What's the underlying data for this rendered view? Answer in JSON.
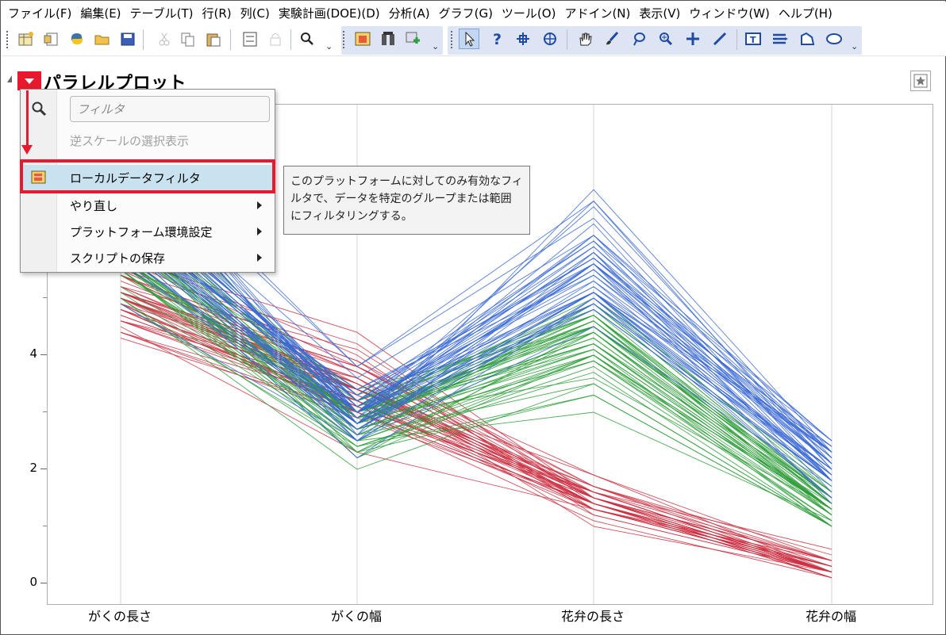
{
  "menubar": {
    "items": [
      "ファイル(F)",
      "編集(E)",
      "テーブル(T)",
      "行(R)",
      "列(C)",
      "実験計画(DOE)(D)",
      "分析(A)",
      "グラフ(G)",
      "ツール(O)",
      "アドイン(N)",
      "表示(V)",
      "ウィンドウ(W)",
      "ヘルプ(H)"
    ]
  },
  "toolbar": {
    "icons": [
      "new-data-table-icon",
      "new-script-icon",
      "python-icon",
      "open-folder-icon",
      "save-icon",
      "cut-icon",
      "copy-icon",
      "paste-icon",
      "fit-window-icon",
      "lock-icon",
      "search-icon",
      "data-table-icon",
      "column-icon",
      "add-icon",
      "arrow-tool-icon",
      "help-tool-icon",
      "crosshair-tool-icon",
      "target-tool-icon",
      "hand-tool-icon",
      "brush-tool-icon",
      "lasso-tool-icon",
      "zoom-tool-icon",
      "plus-tool-icon",
      "line-tool-icon",
      "text-tool-icon",
      "list-tool-icon",
      "shape-tool-icon",
      "ellipse-tool-icon"
    ]
  },
  "report": {
    "title": "パラレルプロット"
  },
  "context_menu": {
    "filter_placeholder": "フィルタ",
    "items": [
      {
        "label": "逆スケールの選択表示",
        "disabled": true
      },
      {
        "label": "ローカルデータフィルタ",
        "highlighted": true
      },
      {
        "label": "やり直し",
        "submenu": true
      },
      {
        "label": "プラットフォーム環境設定",
        "submenu": true
      },
      {
        "label": "スクリプトの保存",
        "submenu": true
      }
    ]
  },
  "tooltip": {
    "lines": [
      "このプラットフォームに対してのみ有効なフィ",
      "ルタで、データを特定のグループまたは範囲",
      "にフィルタリングする。"
    ]
  },
  "colors": {
    "accent_red": "#e8192c",
    "setosa": "#cc3344",
    "versicolor": "#2e9e3a",
    "virginica": "#3a68d6"
  },
  "chart_data": {
    "type": "line",
    "title": "パラレルプロット",
    "categories": [
      "がくの長さ",
      "がくの幅",
      "花弁の長さ",
      "花弁の幅"
    ],
    "y_ticks": [
      "0",
      "2",
      "4"
    ],
    "ylim": [
      0,
      8.9
    ],
    "grid": true,
    "series": [
      {
        "group": "setosa",
        "color": "#cc3344",
        "lines": [
          [
            5.1,
            3.5,
            1.4,
            0.2
          ],
          [
            4.9,
            3.0,
            1.4,
            0.2
          ],
          [
            4.7,
            3.2,
            1.3,
            0.2
          ],
          [
            4.6,
            3.1,
            1.5,
            0.2
          ],
          [
            5.0,
            3.6,
            1.4,
            0.2
          ],
          [
            5.4,
            3.9,
            1.7,
            0.4
          ],
          [
            4.6,
            3.4,
            1.4,
            0.3
          ],
          [
            5.0,
            3.4,
            1.5,
            0.2
          ],
          [
            4.4,
            2.9,
            1.4,
            0.2
          ],
          [
            4.9,
            3.1,
            1.5,
            0.1
          ],
          [
            5.4,
            3.7,
            1.5,
            0.2
          ],
          [
            4.8,
            3.4,
            1.6,
            0.2
          ],
          [
            4.8,
            3.0,
            1.4,
            0.1
          ],
          [
            4.3,
            3.0,
            1.1,
            0.1
          ],
          [
            5.8,
            4.0,
            1.2,
            0.2
          ],
          [
            5.7,
            4.4,
            1.5,
            0.4
          ],
          [
            5.4,
            3.9,
            1.3,
            0.4
          ],
          [
            5.1,
            3.5,
            1.4,
            0.3
          ],
          [
            5.7,
            3.8,
            1.7,
            0.3
          ],
          [
            5.1,
            3.8,
            1.5,
            0.3
          ],
          [
            5.4,
            3.4,
            1.7,
            0.2
          ],
          [
            5.1,
            3.7,
            1.5,
            0.4
          ],
          [
            4.6,
            3.6,
            1.0,
            0.2
          ],
          [
            5.1,
            3.3,
            1.7,
            0.5
          ],
          [
            4.8,
            3.4,
            1.9,
            0.2
          ],
          [
            5.0,
            3.0,
            1.6,
            0.2
          ],
          [
            5.0,
            3.4,
            1.6,
            0.4
          ],
          [
            5.2,
            3.5,
            1.5,
            0.2
          ],
          [
            5.2,
            3.4,
            1.4,
            0.2
          ],
          [
            4.7,
            3.2,
            1.6,
            0.2
          ],
          [
            4.8,
            3.1,
            1.6,
            0.2
          ],
          [
            5.4,
            3.4,
            1.5,
            0.4
          ],
          [
            5.2,
            4.1,
            1.5,
            0.1
          ],
          [
            5.5,
            4.2,
            1.4,
            0.2
          ],
          [
            4.9,
            3.1,
            1.5,
            0.2
          ],
          [
            5.0,
            3.2,
            1.2,
            0.2
          ],
          [
            5.5,
            3.5,
            1.3,
            0.2
          ],
          [
            4.9,
            3.6,
            1.4,
            0.1
          ],
          [
            4.4,
            3.0,
            1.3,
            0.2
          ],
          [
            5.1,
            3.4,
            1.5,
            0.2
          ],
          [
            5.0,
            3.5,
            1.3,
            0.3
          ],
          [
            4.5,
            2.3,
            1.3,
            0.3
          ],
          [
            4.4,
            3.2,
            1.3,
            0.2
          ],
          [
            5.0,
            3.5,
            1.6,
            0.6
          ],
          [
            5.1,
            3.8,
            1.9,
            0.4
          ],
          [
            4.8,
            3.0,
            1.4,
            0.3
          ],
          [
            5.1,
            3.8,
            1.6,
            0.2
          ],
          [
            4.6,
            3.2,
            1.4,
            0.2
          ],
          [
            5.3,
            3.7,
            1.5,
            0.2
          ],
          [
            5.0,
            3.3,
            1.4,
            0.2
          ]
        ]
      },
      {
        "group": "versicolor",
        "color": "#2e9e3a",
        "lines": [
          [
            7.0,
            3.2,
            4.7,
            1.4
          ],
          [
            6.4,
            3.2,
            4.5,
            1.5
          ],
          [
            6.9,
            3.1,
            4.9,
            1.5
          ],
          [
            5.5,
            2.3,
            4.0,
            1.3
          ],
          [
            6.5,
            2.8,
            4.6,
            1.5
          ],
          [
            5.7,
            2.8,
            4.5,
            1.3
          ],
          [
            6.3,
            3.3,
            4.7,
            1.6
          ],
          [
            4.9,
            2.4,
            3.3,
            1.0
          ],
          [
            6.6,
            2.9,
            4.6,
            1.3
          ],
          [
            5.2,
            2.7,
            3.9,
            1.4
          ],
          [
            5.0,
            2.0,
            3.5,
            1.0
          ],
          [
            5.9,
            3.0,
            4.2,
            1.5
          ],
          [
            6.0,
            2.2,
            4.0,
            1.0
          ],
          [
            6.1,
            2.9,
            4.7,
            1.4
          ],
          [
            5.6,
            2.9,
            3.6,
            1.3
          ],
          [
            6.7,
            3.1,
            4.4,
            1.4
          ],
          [
            5.6,
            3.0,
            4.5,
            1.5
          ],
          [
            5.8,
            2.7,
            4.1,
            1.0
          ],
          [
            6.2,
            2.2,
            4.5,
            1.5
          ],
          [
            5.6,
            2.5,
            3.9,
            1.1
          ],
          [
            5.9,
            3.2,
            4.8,
            1.8
          ],
          [
            6.1,
            2.8,
            4.0,
            1.3
          ],
          [
            6.3,
            2.5,
            4.9,
            1.5
          ],
          [
            6.1,
            2.8,
            4.7,
            1.2
          ],
          [
            6.4,
            2.9,
            4.3,
            1.3
          ],
          [
            6.6,
            3.0,
            4.4,
            1.4
          ],
          [
            6.8,
            2.8,
            4.8,
            1.4
          ],
          [
            6.7,
            3.0,
            5.0,
            1.7
          ],
          [
            6.0,
            2.9,
            4.5,
            1.5
          ],
          [
            5.7,
            2.6,
            3.5,
            1.0
          ],
          [
            5.5,
            2.4,
            3.8,
            1.1
          ],
          [
            5.5,
            2.4,
            3.7,
            1.0
          ],
          [
            5.8,
            2.7,
            3.9,
            1.2
          ],
          [
            6.0,
            2.7,
            5.1,
            1.6
          ],
          [
            5.4,
            3.0,
            4.5,
            1.5
          ],
          [
            6.0,
            3.4,
            4.5,
            1.6
          ],
          [
            6.7,
            3.1,
            4.7,
            1.5
          ],
          [
            6.3,
            2.3,
            4.4,
            1.3
          ],
          [
            5.6,
            3.0,
            4.1,
            1.3
          ],
          [
            5.5,
            2.5,
            4.0,
            1.3
          ],
          [
            5.5,
            2.6,
            4.4,
            1.2
          ],
          [
            6.1,
            3.0,
            4.6,
            1.4
          ],
          [
            5.8,
            2.6,
            4.0,
            1.2
          ],
          [
            5.0,
            2.3,
            3.3,
            1.0
          ],
          [
            5.6,
            2.7,
            4.2,
            1.3
          ],
          [
            5.7,
            3.0,
            4.2,
            1.2
          ],
          [
            5.7,
            2.9,
            4.2,
            1.3
          ],
          [
            6.2,
            2.9,
            4.3,
            1.3
          ],
          [
            5.1,
            2.5,
            3.0,
            1.1
          ],
          [
            5.7,
            2.8,
            4.1,
            1.3
          ]
        ]
      },
      {
        "group": "virginica",
        "color": "#3a68d6",
        "lines": [
          [
            6.3,
            3.3,
            6.0,
            2.5
          ],
          [
            5.8,
            2.7,
            5.1,
            1.9
          ],
          [
            7.1,
            3.0,
            5.9,
            2.1
          ],
          [
            6.3,
            2.9,
            5.6,
            1.8
          ],
          [
            6.5,
            3.0,
            5.8,
            2.2
          ],
          [
            7.6,
            3.0,
            6.6,
            2.1
          ],
          [
            4.9,
            2.5,
            4.5,
            1.7
          ],
          [
            7.3,
            2.9,
            6.3,
            1.8
          ],
          [
            6.7,
            2.5,
            5.8,
            1.8
          ],
          [
            7.2,
            3.6,
            6.1,
            2.5
          ],
          [
            6.5,
            3.2,
            5.1,
            2.0
          ],
          [
            6.4,
            2.7,
            5.3,
            1.9
          ],
          [
            6.8,
            3.0,
            5.5,
            2.1
          ],
          [
            5.7,
            2.5,
            5.0,
            2.0
          ],
          [
            5.8,
            2.8,
            5.1,
            2.4
          ],
          [
            6.4,
            3.2,
            5.3,
            2.3
          ],
          [
            6.5,
            3.0,
            5.5,
            1.8
          ],
          [
            7.7,
            3.8,
            6.7,
            2.2
          ],
          [
            7.7,
            2.6,
            6.9,
            2.3
          ],
          [
            6.0,
            2.2,
            5.0,
            1.5
          ],
          [
            6.9,
            3.2,
            5.7,
            2.3
          ],
          [
            5.6,
            2.8,
            4.9,
            2.0
          ],
          [
            7.7,
            2.8,
            6.7,
            2.0
          ],
          [
            6.3,
            2.7,
            4.9,
            1.8
          ],
          [
            6.7,
            3.3,
            5.7,
            2.1
          ],
          [
            7.2,
            3.2,
            6.0,
            1.8
          ],
          [
            6.2,
            2.8,
            4.8,
            1.8
          ],
          [
            6.1,
            3.0,
            4.9,
            1.8
          ],
          [
            6.4,
            2.8,
            5.6,
            2.1
          ],
          [
            7.2,
            3.0,
            5.8,
            1.6
          ],
          [
            7.4,
            2.8,
            6.1,
            1.9
          ],
          [
            7.9,
            3.8,
            6.4,
            2.0
          ],
          [
            6.4,
            2.8,
            5.6,
            2.2
          ],
          [
            6.3,
            2.8,
            5.1,
            1.5
          ],
          [
            6.1,
            2.6,
            5.6,
            1.4
          ],
          [
            7.7,
            3.0,
            6.1,
            2.3
          ],
          [
            6.3,
            3.4,
            5.6,
            2.4
          ],
          [
            6.4,
            3.1,
            5.5,
            1.8
          ],
          [
            6.0,
            3.0,
            4.8,
            1.8
          ],
          [
            6.9,
            3.1,
            5.4,
            2.1
          ],
          [
            6.7,
            3.1,
            5.6,
            2.4
          ],
          [
            6.9,
            3.1,
            5.1,
            2.3
          ],
          [
            5.8,
            2.7,
            5.1,
            1.9
          ],
          [
            6.8,
            3.2,
            5.9,
            2.3
          ],
          [
            6.7,
            3.3,
            5.7,
            2.5
          ],
          [
            6.7,
            3.0,
            5.2,
            2.3
          ],
          [
            6.3,
            2.5,
            5.0,
            1.9
          ],
          [
            6.5,
            3.0,
            5.2,
            2.0
          ],
          [
            6.2,
            3.4,
            5.4,
            2.3
          ],
          [
            5.9,
            3.0,
            5.1,
            1.8
          ]
        ]
      }
    ]
  }
}
